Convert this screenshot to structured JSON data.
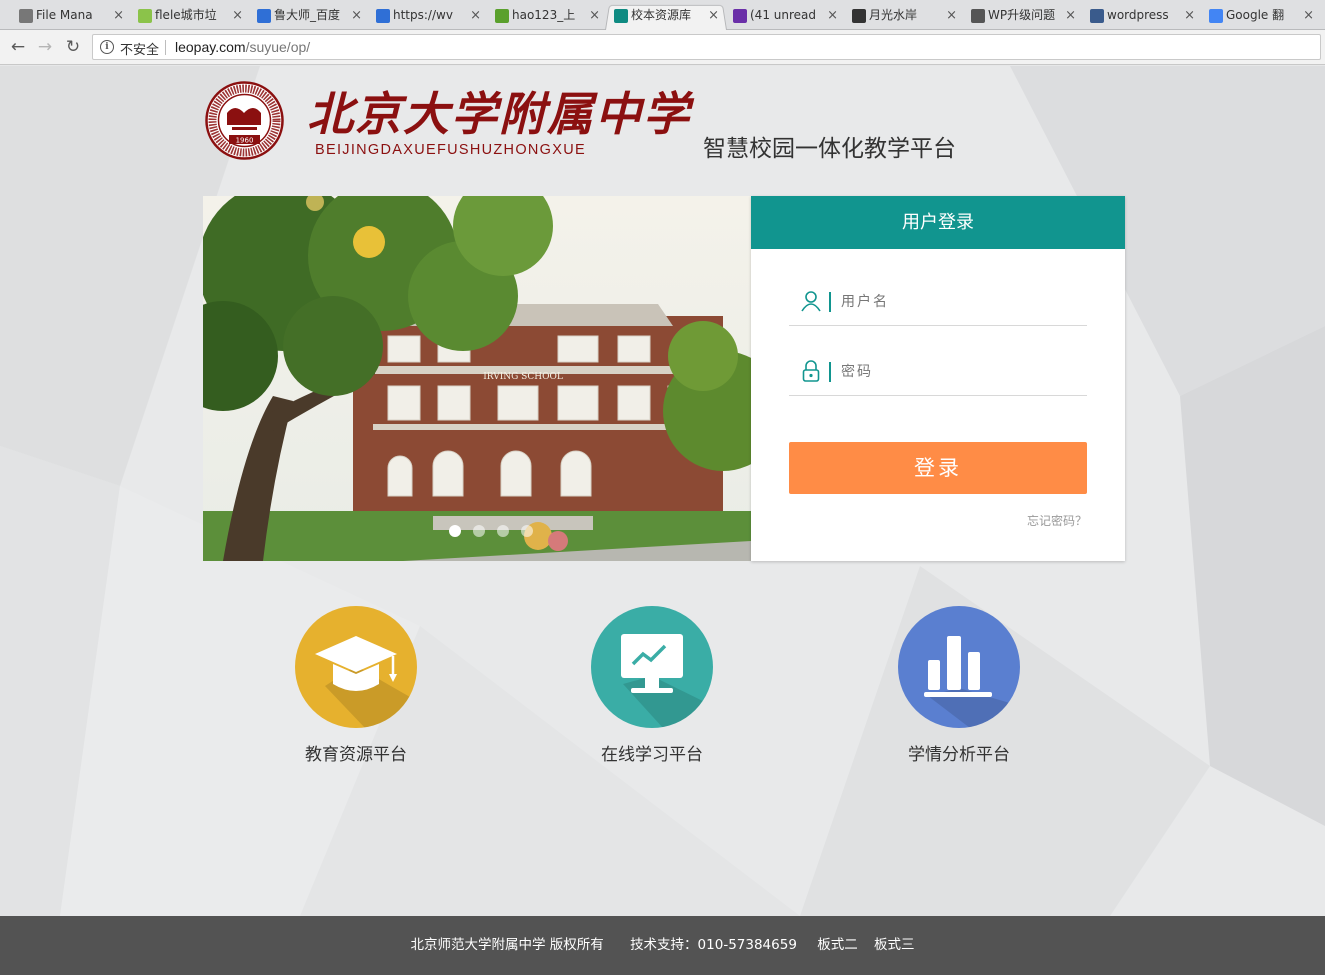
{
  "browser": {
    "tabs": [
      {
        "title": "File Mana",
        "favicon": "file-manager-icon",
        "color": "#777777",
        "active": false
      },
      {
        "title": "flele城市垃",
        "favicon": "chat-icon",
        "color": "#8bc34a",
        "active": false
      },
      {
        "title": "鲁大师_百度",
        "favicon": "baidu-paw-icon",
        "color": "#2f6fd6",
        "active": false
      },
      {
        "title": "https://wv",
        "favicon": "baidu-paw-icon",
        "color": "#2f6fd6",
        "active": false
      },
      {
        "title": "hao123_上",
        "favicon": "hao123-icon",
        "color": "#5aa02c",
        "active": false
      },
      {
        "title": "校本资源库",
        "favicon": "school-icon",
        "color": "#0f8b82",
        "active": true
      },
      {
        "title": "(41 unread",
        "favicon": "mail-icon",
        "color": "#6a2fa8",
        "active": false
      },
      {
        "title": "月光水岸",
        "favicon": "moon-site-icon",
        "color": "#333333",
        "active": false
      },
      {
        "title": "WP升级问题",
        "favicon": "code-icon",
        "color": "#555555",
        "active": false
      },
      {
        "title": "wordpress",
        "favicon": "fleur-icon",
        "color": "#3a5b8c",
        "active": false
      },
      {
        "title": "Google 翻",
        "favicon": "google-translate-icon",
        "color": "#4285f4",
        "active": false
      }
    ],
    "tab_close_glyph": "×",
    "nav": {
      "back": "←",
      "forward": "→",
      "reload": "↻"
    },
    "security_label": "不安全",
    "url_host": "leopay.com",
    "url_path": "/suyue/op/"
  },
  "header": {
    "school_name": "北京大学附属中学",
    "school_pinyin": "BEIJINGDAXUEFUSHUZHONGXUE",
    "seal_year": "1960",
    "seal_ring_text": "THE AFFILIATED HIGH SCHOOL OF PEKING UNIVERSITY",
    "platform_title": "智慧校园一体化教学平台"
  },
  "slider": {
    "building_sign": "IRVING SCHOOL",
    "dots": 4,
    "active_dot": 0
  },
  "login": {
    "title": "用户登录",
    "username_placeholder": "用户名",
    "password_placeholder": "密码",
    "submit_label": "登录",
    "forgot_label": "忘记密码？",
    "accent_color": "#11958f",
    "button_color": "#ff8c46"
  },
  "platforms": [
    {
      "label": "教育资源平台",
      "icon": "graduation-cap-icon",
      "color": "#e6b12e"
    },
    {
      "label": "在线学习平台",
      "icon": "monitor-chart-icon",
      "color": "#3aada6"
    },
    {
      "label": "学情分析平台",
      "icon": "bar-chart-icon",
      "color": "#5a7fd0"
    }
  ],
  "footer": {
    "copyright": "北京师范大学附属中学 版权所有",
    "support": "技术支持：010-57384659",
    "link1": "板式二",
    "link2": "板式三"
  }
}
